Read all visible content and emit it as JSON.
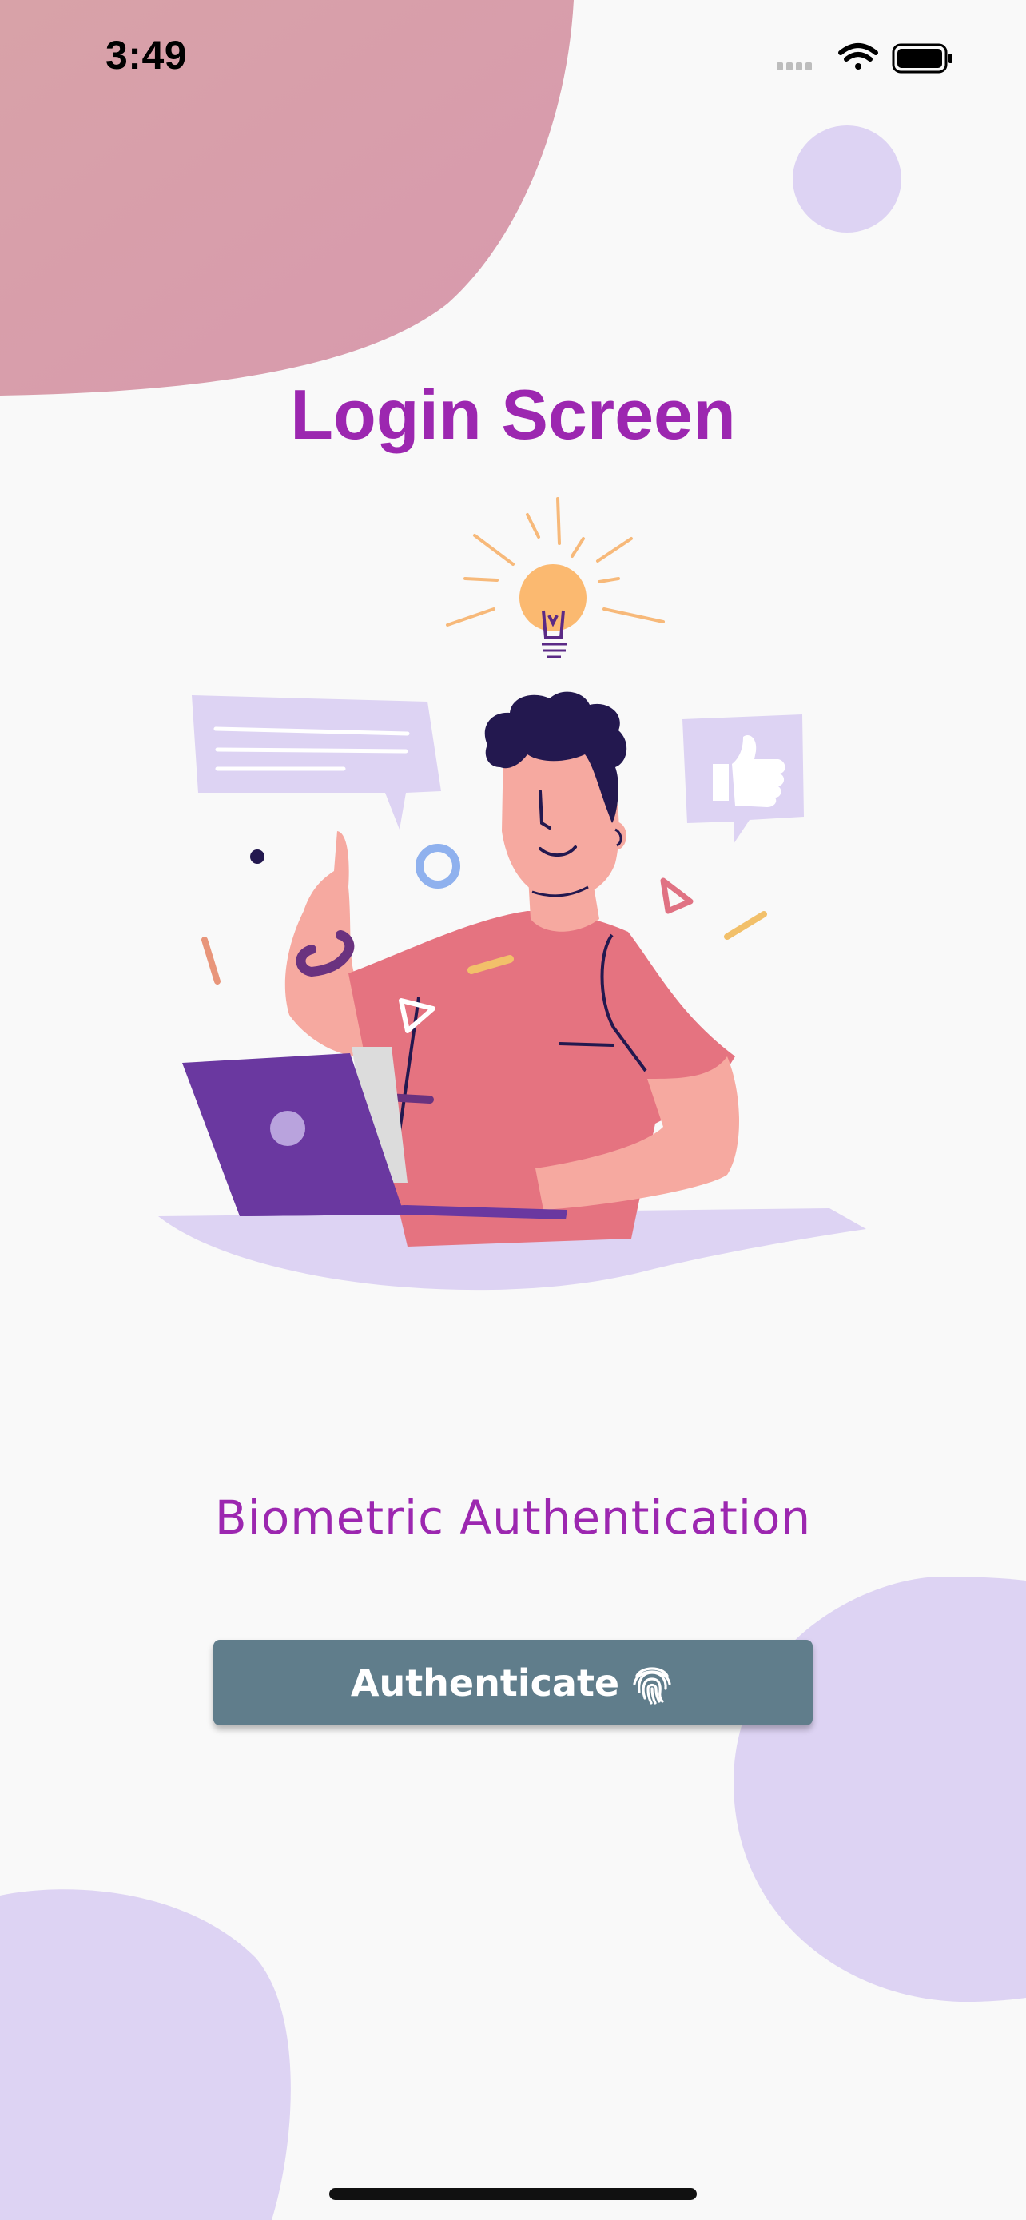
{
  "status_bar": {
    "time": "3:49",
    "icons": [
      "signal-icon",
      "wifi-icon",
      "battery-icon"
    ]
  },
  "title": "Login Screen",
  "illustration": {
    "icon": "person-at-laptop-with-idea-illustration"
  },
  "subtitle": "Biometric Authentication",
  "button": {
    "label": "Authenticate",
    "icon": "fingerprint-icon"
  },
  "colors": {
    "background": "#f9f9f9",
    "accent": "#9c27b0",
    "button": "#607d8b",
    "blob_pink": "#d89aa9",
    "blob_lavender": "#ddd3f3"
  }
}
